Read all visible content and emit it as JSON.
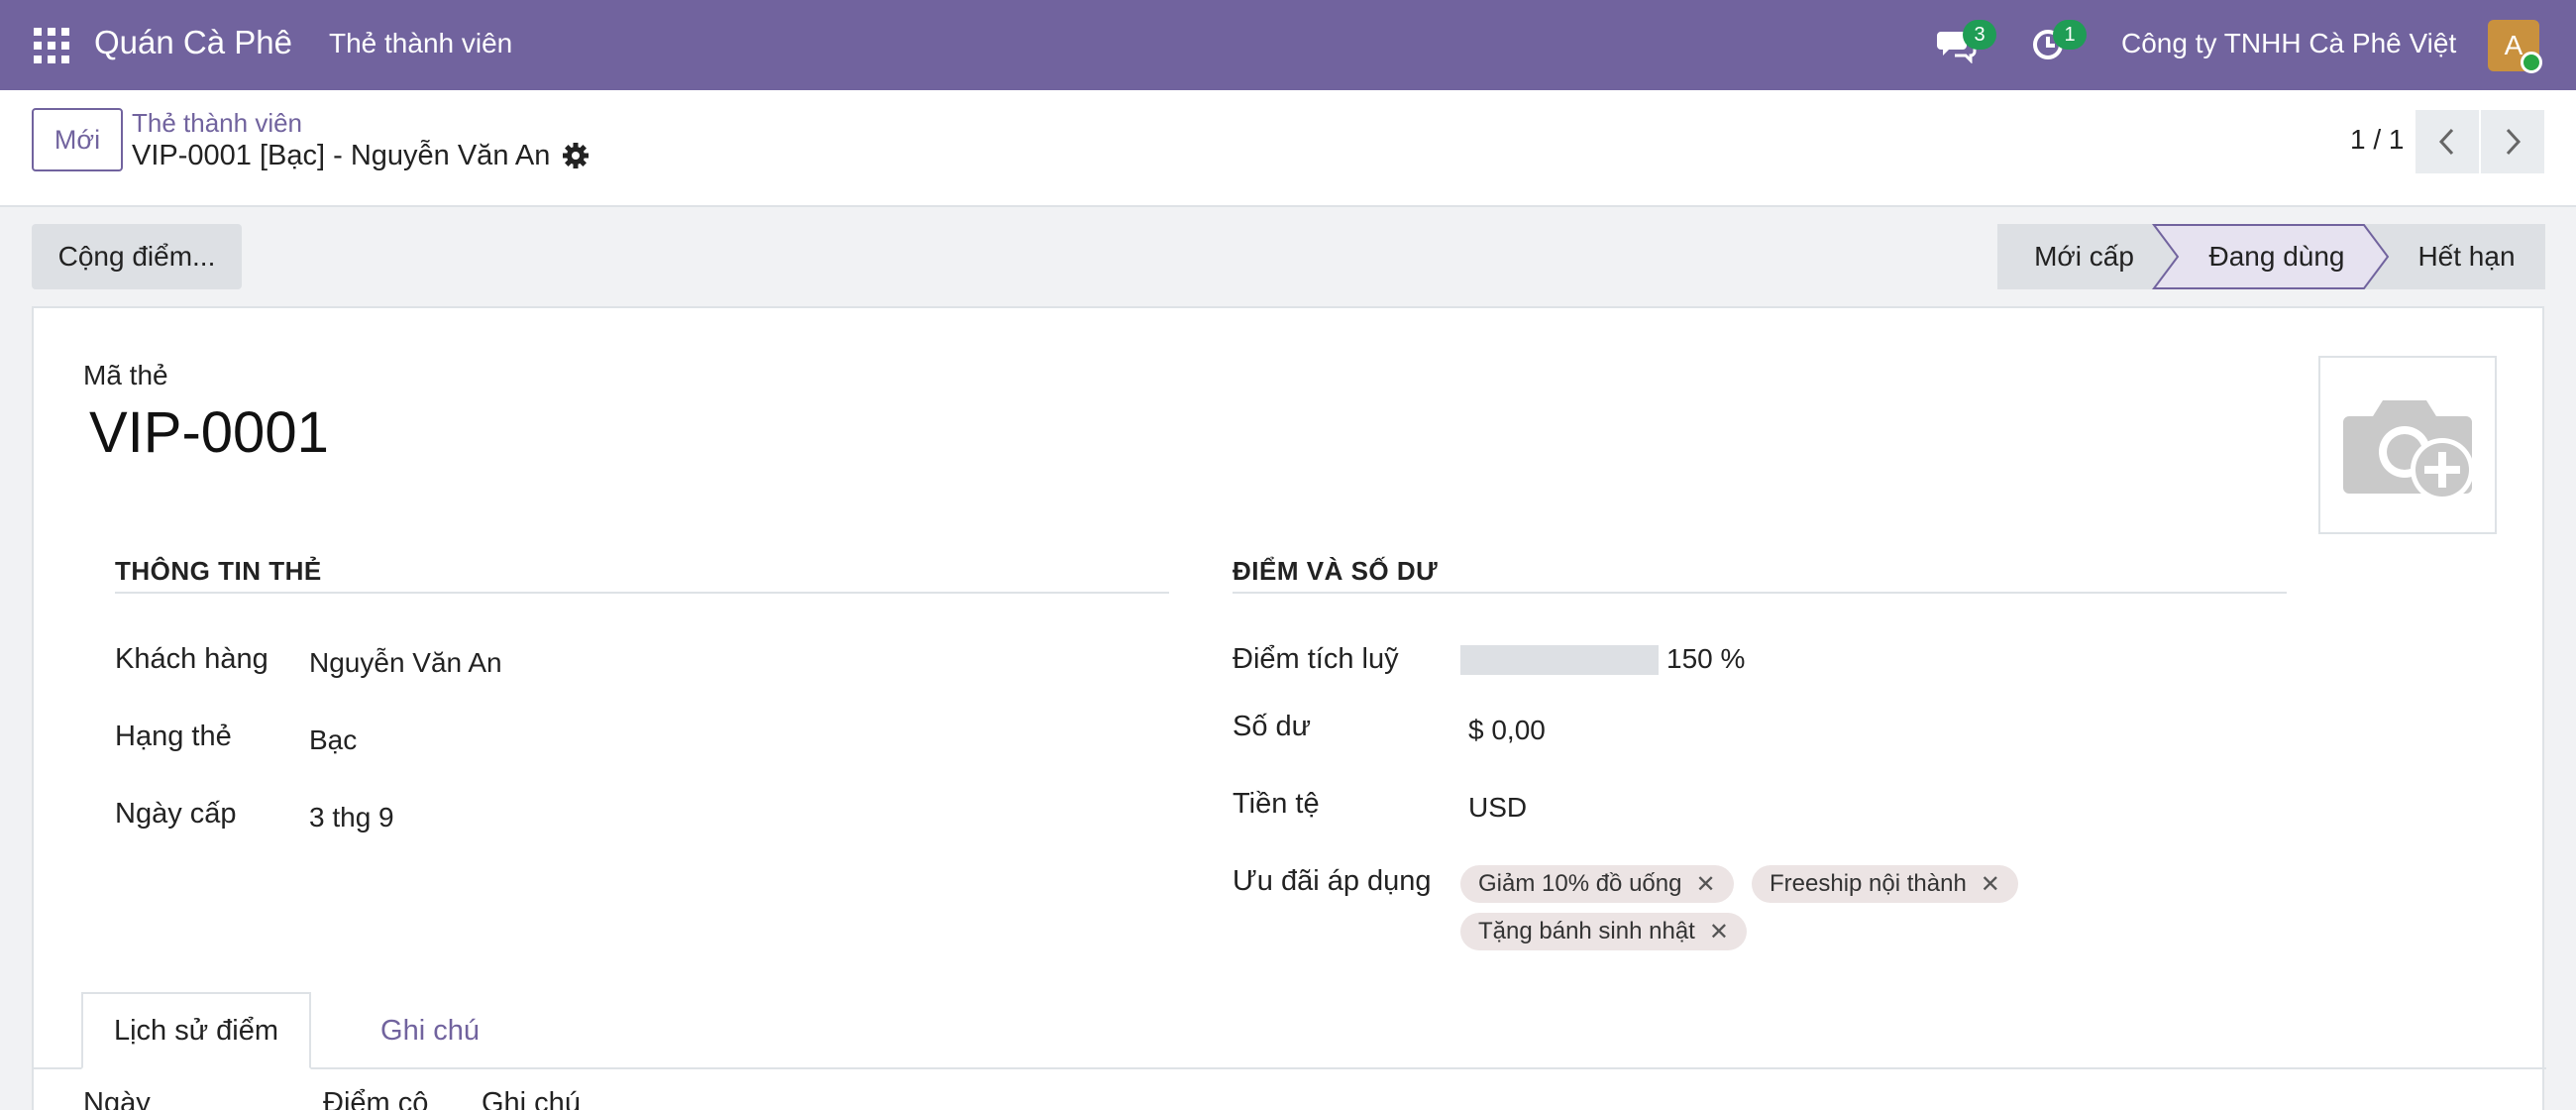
{
  "navbar": {
    "brand": "Quán Cà Phê",
    "menu": "Thẻ thành viên",
    "messages_count": "3",
    "activities_count": "1",
    "company": "Công ty TNHH Cà Phê Việt",
    "avatar_initial": "A"
  },
  "control": {
    "new_label": "Mới",
    "breadcrumb_parent": "Thẻ thành viên",
    "breadcrumb_current": "VIP-0001 [Bạc] - Nguyễn Văn An",
    "pager": "1 / 1"
  },
  "actions": {
    "add_points": "Cộng điểm..."
  },
  "status": {
    "stages": [
      "Mới cấp",
      "Đang dùng",
      "Hết hạn"
    ],
    "current": "Đang dùng"
  },
  "form": {
    "code_label": "Mã thẻ",
    "code_value": "VIP-0001",
    "card_info": {
      "title": "THÔNG TIN THẺ",
      "customer_label": "Khách hàng",
      "customer_value": "Nguyễn Văn An",
      "tier_label": "Hạng thẻ",
      "tier_value": "Bạc",
      "issue_date_label": "Ngày cấp",
      "issue_date_value": "3 thg 9"
    },
    "points_info": {
      "title": "ĐIỂM VÀ SỐ DƯ",
      "points_label": "Điểm tích luỹ",
      "points_percent": 150,
      "points_text": "150 %",
      "balance_label": "Số dư",
      "balance_value": "$ 0,00",
      "currency_label": "Tiền tệ",
      "currency_value": "USD",
      "offers_label": "Ưu đãi áp dụng",
      "offers": [
        "Giảm 10% đồ uống",
        "Freeship nội thành",
        "Tặng bánh sinh nhật"
      ]
    }
  },
  "tabs": {
    "history": "Lịch sử điểm",
    "notes": "Ghi chú"
  },
  "table": {
    "columns": [
      "Ngày",
      "Điểm cộ",
      "Ghi chú"
    ]
  },
  "colors": {
    "brand": "#71639e",
    "badge": "#1f9d55"
  }
}
